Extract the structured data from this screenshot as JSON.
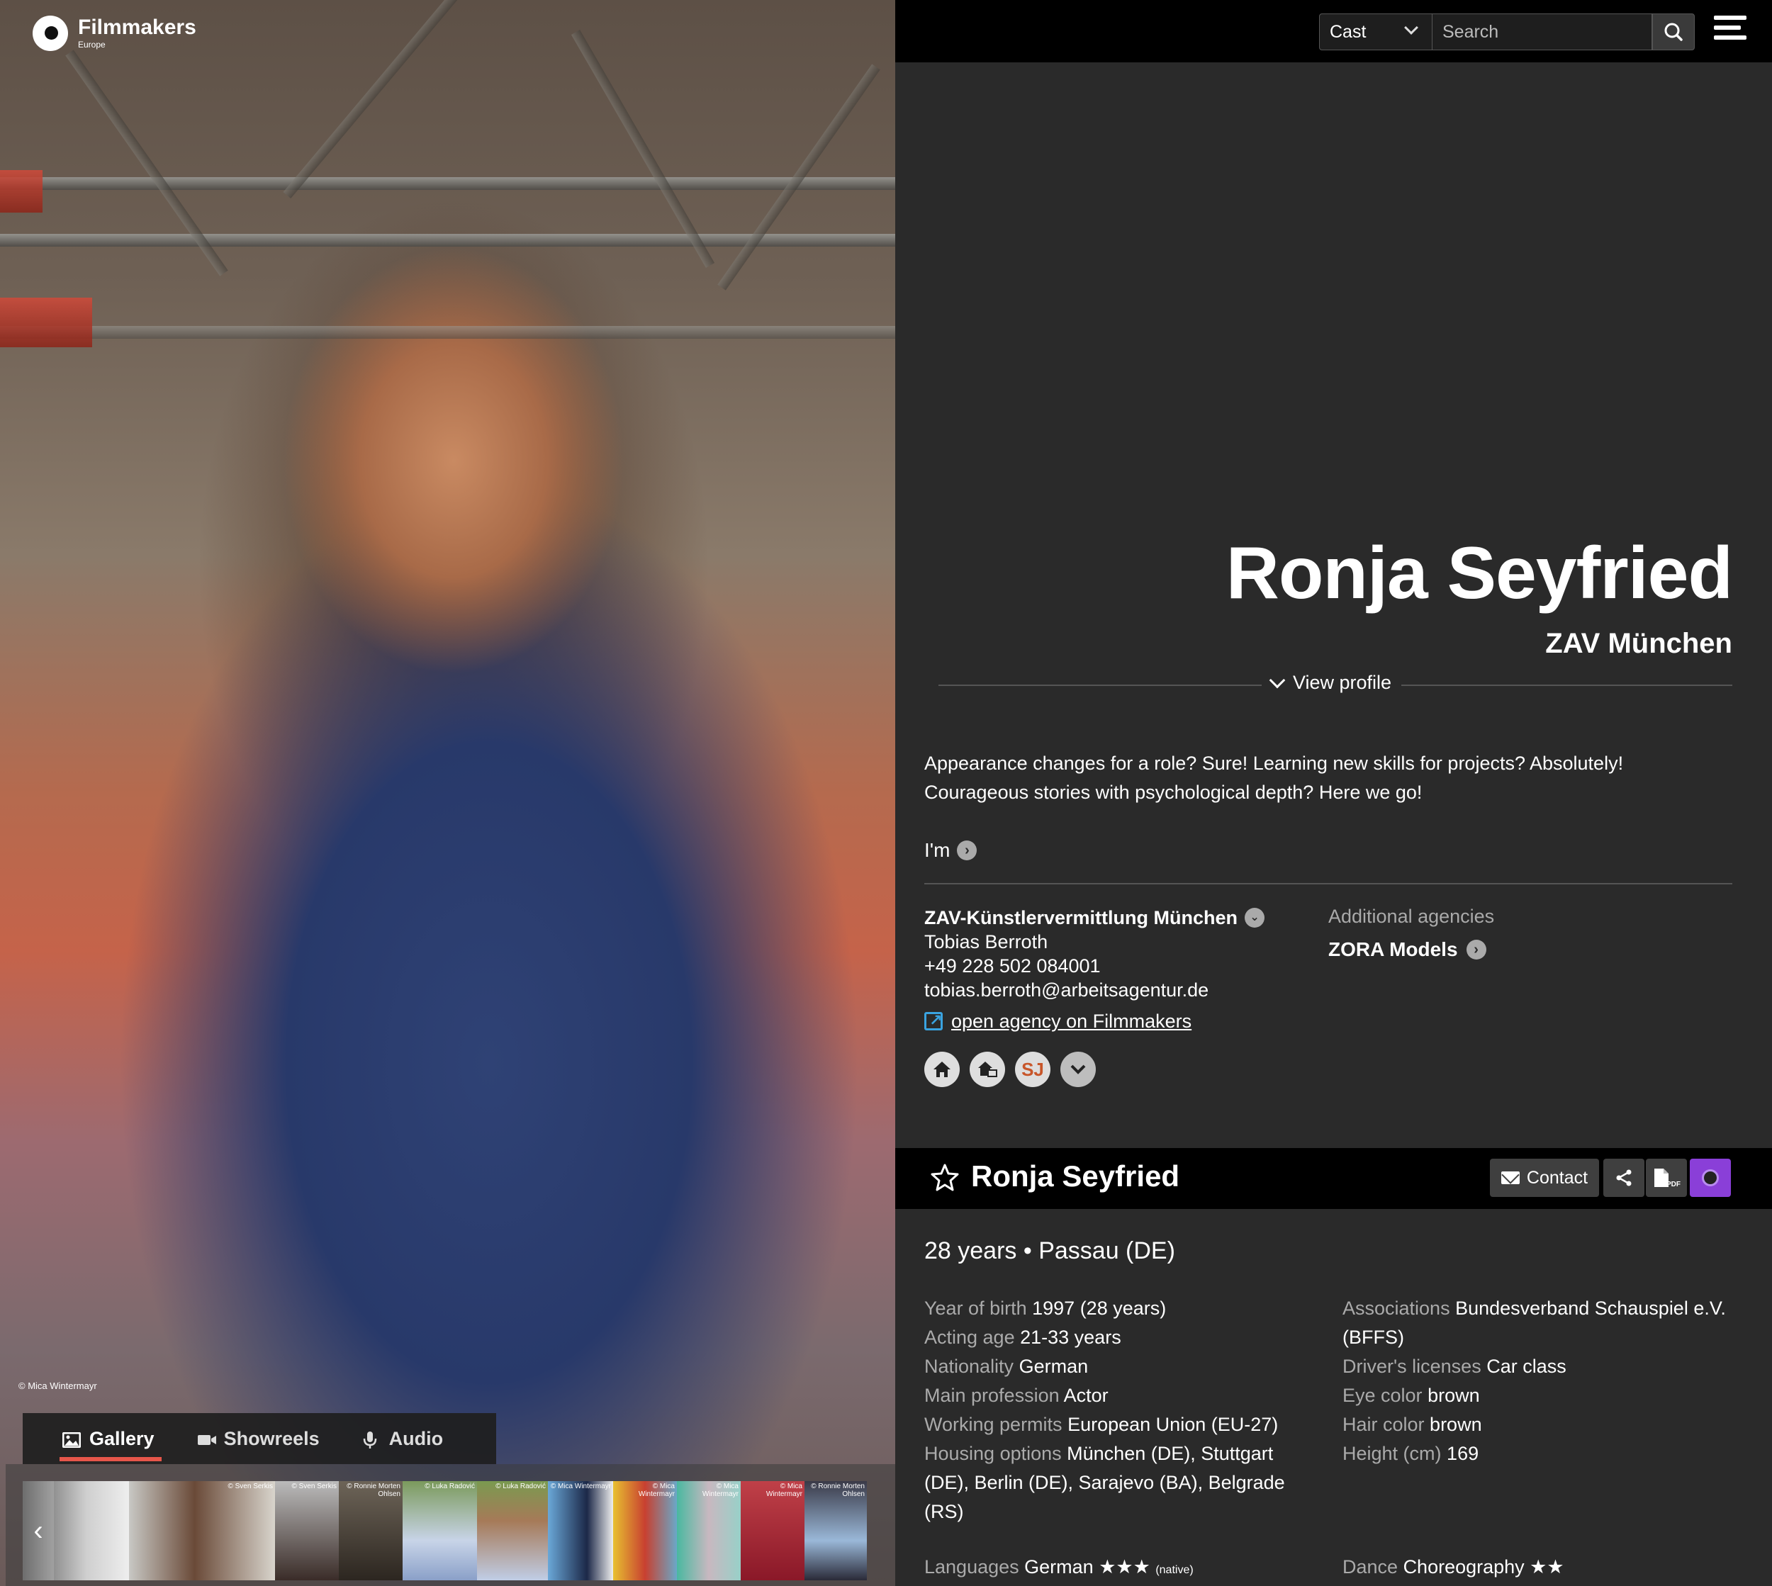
{
  "brand": {
    "name": "Filmmakers",
    "sub": "Europe"
  },
  "search": {
    "category": "Cast",
    "placeholder": "Search"
  },
  "profile": {
    "name": "Ronja Seyfried",
    "agency": "ZAV München",
    "view_profile": "View profile",
    "bio_line1": "Appearance changes for a role? Sure! Learning new skills for projects? Absolutely!",
    "bio_line2": "Courageous stories with psychological depth? Here we go!",
    "im": "I'm"
  },
  "agency": {
    "title": "ZAV-Künstlervermittlung München",
    "contact": "Tobias Berroth",
    "phone": "+49 228 502 084001",
    "email": "tobias.berroth@arbeitsagentur.de",
    "link": "open agency on Filmmakers",
    "additional_label": "Additional agencies",
    "additional_name": "ZORA Models"
  },
  "photo_credit": "© Mica Wintermayr",
  "media_tabs": [
    "Gallery",
    "Showreels",
    "Audio"
  ],
  "thumbnails": [
    {
      "caption": ""
    },
    {
      "caption": "© Sven Serkis"
    },
    {
      "caption": "© Sven Serkis"
    },
    {
      "caption": "© Ronnie Morten Ohlsen"
    },
    {
      "caption": "© Luka Radović"
    },
    {
      "caption": "© Luka Radović"
    },
    {
      "caption": "© Mica Wintermayr"
    },
    {
      "caption": "© Mica Wintermayr"
    },
    {
      "caption": "© Mica Wintermayr"
    },
    {
      "caption": "© Mica Wintermayr"
    },
    {
      "caption": "© Ronnie Morten Ohlsen"
    }
  ],
  "namebar": {
    "name": "Ronja Seyfried",
    "contact": "Contact",
    "pdf": "PDF"
  },
  "summary": {
    "age_location": "28 years • Passau (DE)"
  },
  "facts_left": [
    {
      "k": "Year of birth",
      "v": "1997 (28 years)"
    },
    {
      "k": "Acting age",
      "v": "21-33 years"
    },
    {
      "k": "Nationality",
      "v": "German"
    },
    {
      "k": "Main profession",
      "v": "Actor"
    },
    {
      "k": "Working permits",
      "v": "European Union (EU-27)"
    },
    {
      "k": "Housing options",
      "v": "München (DE), Stuttgart (DE), Berlin (DE), Sarajevo (BA), Belgrade (RS)"
    }
  ],
  "facts_right": [
    {
      "k": "Associations",
      "v": "Bundesverband Schauspiel e.V. (BFFS)"
    },
    {
      "k": "Driver's licenses",
      "v": "Car class"
    },
    {
      "k": "Eye color",
      "v": "brown"
    },
    {
      "k": "Hair color",
      "v": "brown"
    },
    {
      "k": "Height (cm)",
      "v": "169"
    }
  ],
  "languages": {
    "k": "Languages",
    "v": "German ★★★",
    "note": "(native)"
  },
  "dance": {
    "k": "Dance",
    "v": "Choreography ★★"
  },
  "colors": {
    "accent_tab": "#e6564a",
    "eye_button": "#8a3fd8",
    "link_icon": "#3aa3e0"
  }
}
